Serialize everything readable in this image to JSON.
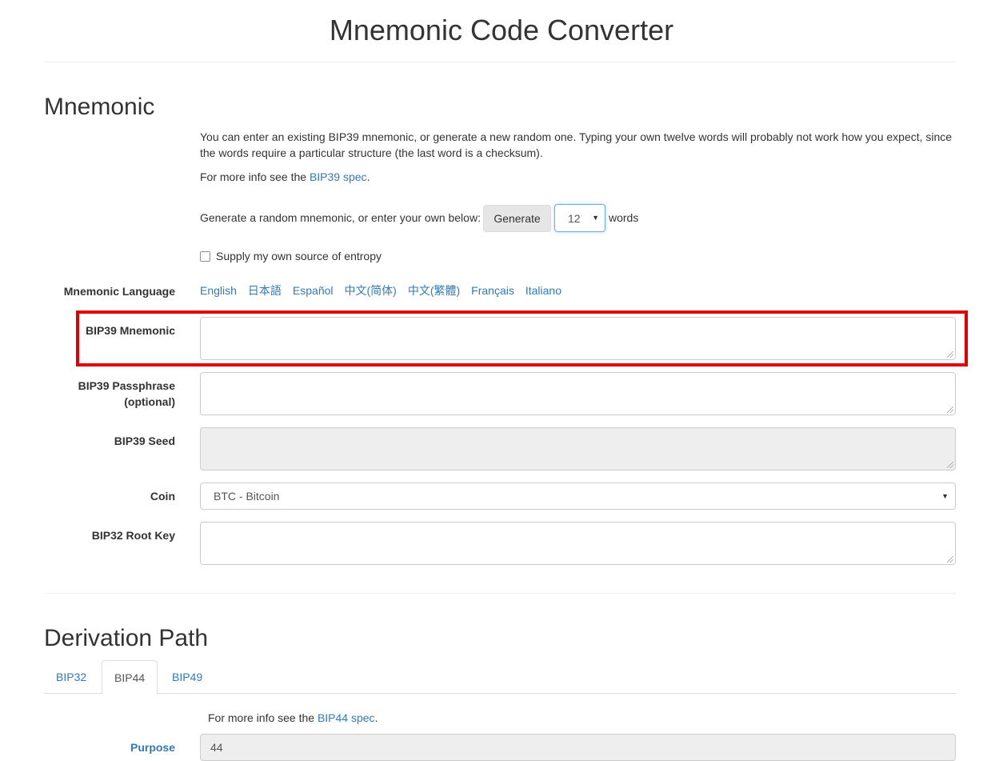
{
  "page": {
    "title": "Mnemonic Code Converter"
  },
  "mnemonic_section": {
    "heading": "Mnemonic",
    "intro": "You can enter an existing BIP39 mnemonic, or generate a new random one. Typing your own twelve words will probably not work how you expect, since the words require a particular structure (the last word is a checksum).",
    "more_info_prefix": "For more info see the ",
    "more_info_link": "BIP39 spec",
    "more_info_suffix": ".",
    "generate_prompt": "Generate a random mnemonic, or enter your own below:",
    "generate_button": "Generate",
    "words_count": "12",
    "words_label": "words",
    "entropy_label": "Supply my own source of entropy",
    "language_label": "Mnemonic Language",
    "languages": [
      "English",
      "日本語",
      "Español",
      "中文(简体)",
      "中文(繁體)",
      "Français",
      "Italiano"
    ],
    "bip39_mnemonic_label": "BIP39 Mnemonic",
    "bip39_passphrase_label_line1": "BIP39 Passphrase",
    "bip39_passphrase_label_line2": "(optional)",
    "bip39_seed_label": "BIP39 Seed",
    "coin_label": "Coin",
    "coin_value": "BTC - Bitcoin",
    "bip32_root_key_label": "BIP32 Root Key"
  },
  "derivation_section": {
    "heading": "Derivation Path",
    "tabs": [
      "BIP32",
      "BIP44",
      "BIP49"
    ],
    "active_tab": "BIP44",
    "more_info_prefix": "For more info see the ",
    "more_info_link": "BIP44 spec",
    "more_info_suffix": ".",
    "purpose_label": "Purpose",
    "purpose_value": "44"
  },
  "colors": {
    "link": "#337ab7",
    "highlight_border": "#e00000",
    "readonly_bg": "#eeeeee"
  }
}
